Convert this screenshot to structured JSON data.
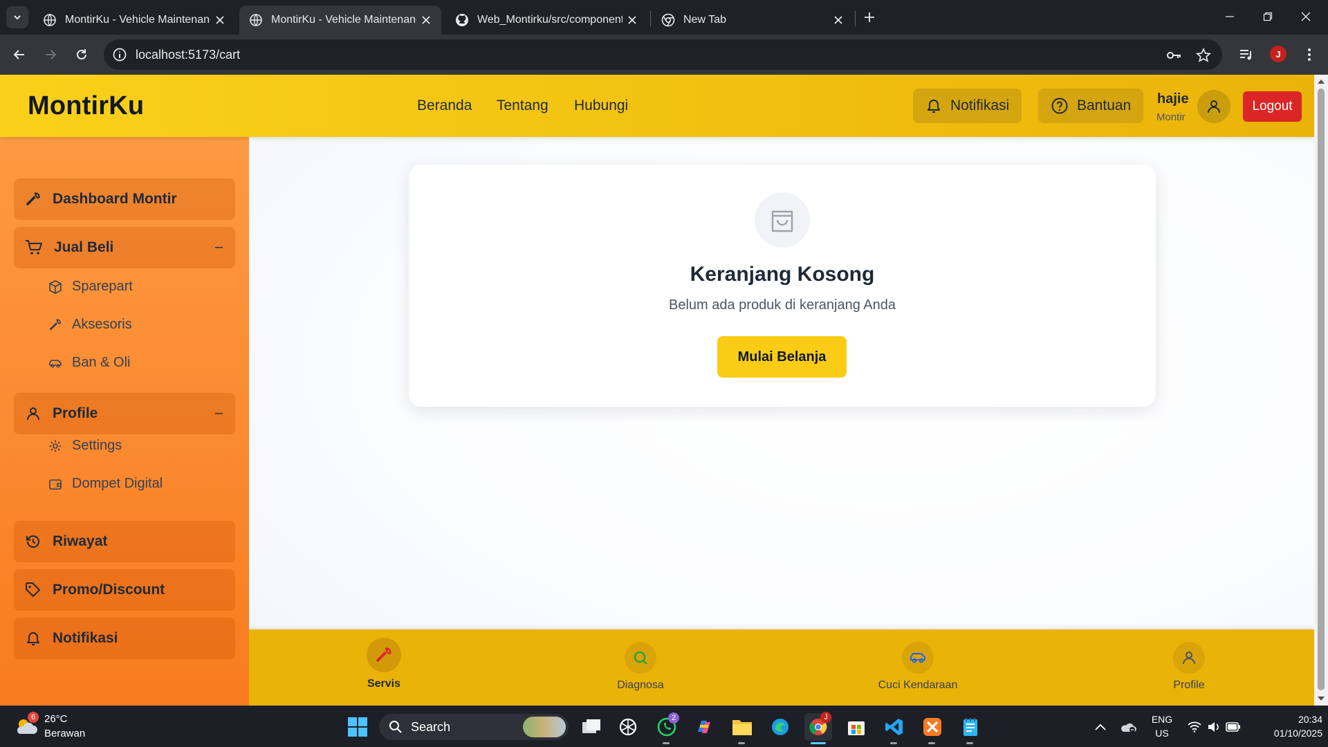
{
  "browser": {
    "tabs": [
      {
        "title": "MontirKu - Vehicle Maintenance",
        "active": false
      },
      {
        "title": "MontirKu - Vehicle Maintenance",
        "active": true
      },
      {
        "title": "Web_Montirku/src/components",
        "active": false
      },
      {
        "title": "New Tab",
        "active": false
      }
    ],
    "url": "localhost:5173/cart",
    "profile_initial": "J"
  },
  "header": {
    "brand": "MontirKu",
    "nav": [
      "Beranda",
      "Tentang",
      "Hubungi"
    ],
    "notif_label": "Notifikasi",
    "help_label": "Bantuan",
    "user_name": "hajie",
    "user_role": "Montir",
    "logout_label": "Logout"
  },
  "sidebar": {
    "dashboard": "Dashboard Montir",
    "jual_beli": "Jual Beli",
    "jual_beli_toggle": "–",
    "jual_beli_sub": [
      "Sparepart",
      "Aksesoris",
      "Ban & Oli"
    ],
    "profile": "Profile",
    "profile_toggle": "–",
    "profile_sub": [
      "Settings",
      "Dompet Digital"
    ],
    "riwayat": "Riwayat",
    "promo": "Promo/Discount",
    "notifikasi": "Notifikasi"
  },
  "cart": {
    "title": "Keranjang Kosong",
    "subtitle": "Belum ada produk di keranjang Anda",
    "button": "Mulai Belanja"
  },
  "bottom_nav": [
    {
      "label": "Servis",
      "active": true
    },
    {
      "label": "Diagnosa",
      "active": false
    },
    {
      "label": "Cuci Kendaraan",
      "active": false
    },
    {
      "label": "Profile",
      "active": false
    }
  ],
  "taskbar": {
    "weather_temp": "26°C",
    "weather_desc": "Berawan",
    "weather_badge": "6",
    "search_label": "Search",
    "whatsapp_badge": "2",
    "chrome_badge": "J",
    "lang_top": "ENG",
    "lang_bottom": "US",
    "time": "20:34",
    "date": "01/10/2025"
  },
  "colors": {
    "header_yellow": "#facc15",
    "sidebar_orange": "#f97b1f",
    "logout_red": "#dc2626",
    "bottom_nav_yellow": "#eab308"
  }
}
